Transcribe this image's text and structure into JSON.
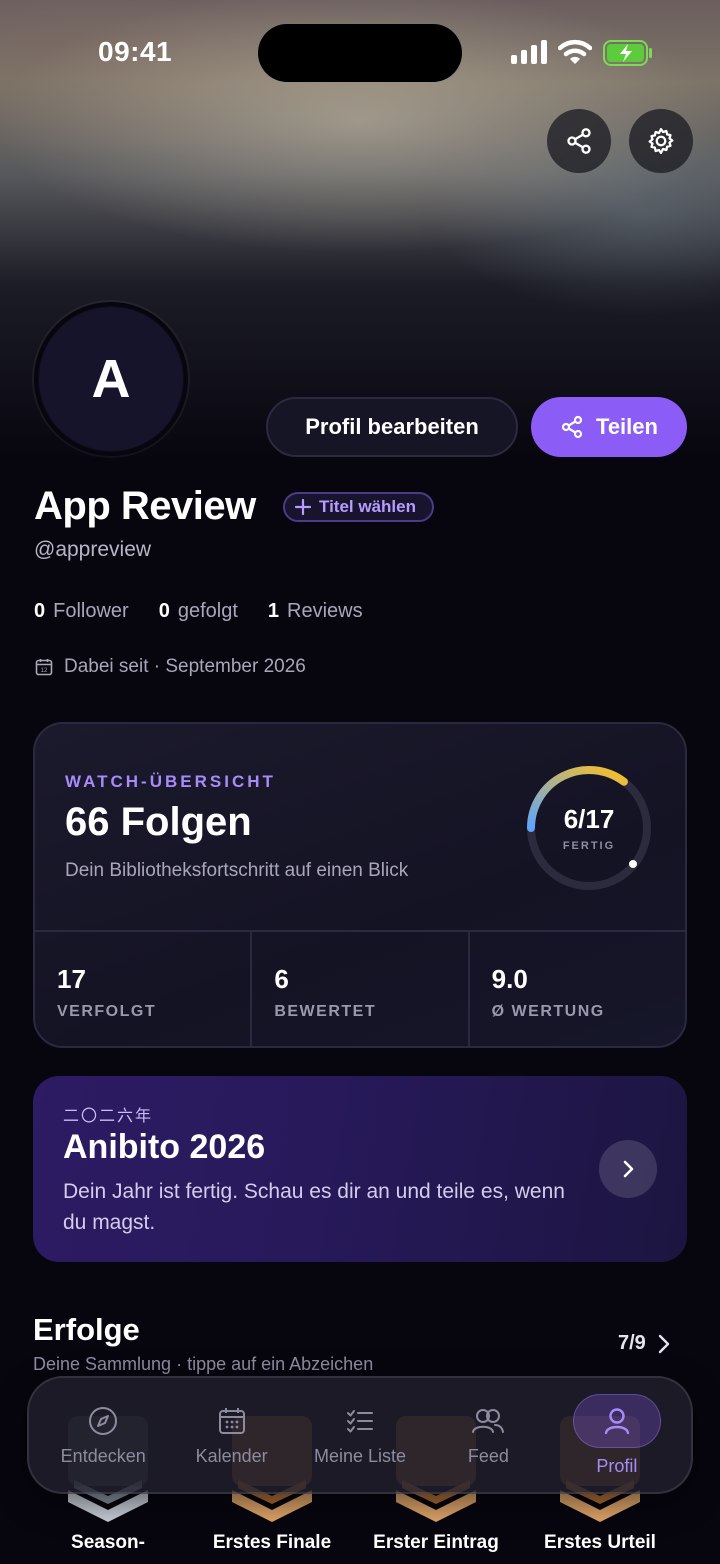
{
  "status_bar": {
    "time": "09:41"
  },
  "profile": {
    "initial": "A",
    "name": "App Review",
    "handle": "@appreview",
    "title_chip": "Titel wählen",
    "edit_button": "Profil bearbeiten",
    "share_button": "Teilen",
    "stats": [
      {
        "value": "0",
        "label": "Follower"
      },
      {
        "value": "0",
        "label": "gefolgt"
      },
      {
        "value": "1",
        "label": "Reviews"
      }
    ],
    "joined": "Dabei seit · September 2026"
  },
  "watch_overview": {
    "eyebrow": "WATCH-ÜBERSICHT",
    "title": "66 Folgen",
    "subtitle": "Dein Bibliotheksfortschritt auf einen Blick",
    "progress_value": "6/17",
    "progress_label": "FERTIG",
    "progress_fraction": 0.353,
    "stats": [
      {
        "value": "17",
        "label": "VERFOLGT"
      },
      {
        "value": "6",
        "label": "BEWERTET"
      },
      {
        "value": "9.0",
        "label": "Ø WERTUNG"
      }
    ]
  },
  "year_review": {
    "eyebrow": "二〇二六年",
    "title": "Anibito 2026",
    "description": "Dein Jahr ist fertig. Schau es dir an und teile es, wenn du magst."
  },
  "achievements": {
    "title": "Erfolge",
    "subtitle": "Deine Sammlung · tippe auf ein Abzeichen",
    "count": "7/9",
    "badges": [
      {
        "label": "Season-",
        "tier": "silver"
      },
      {
        "label": "Erstes Finale",
        "tier": "bronze"
      },
      {
        "label": "Erster Eintrag",
        "tier": "bronze"
      },
      {
        "label": "Erstes Urteil",
        "tier": "bronze"
      }
    ]
  },
  "tabs": [
    {
      "label": "Entdecken",
      "icon": "compass-icon"
    },
    {
      "label": "Kalender",
      "icon": "calendar-icon"
    },
    {
      "label": "Meine Liste",
      "icon": "checklist-icon"
    },
    {
      "label": "Feed",
      "icon": "users-icon"
    },
    {
      "label": "Profil",
      "icon": "person-icon",
      "active": true
    }
  ],
  "colors": {
    "accent": "#8b5cf6",
    "accent_light": "#a78bfa",
    "background": "#07060f"
  }
}
